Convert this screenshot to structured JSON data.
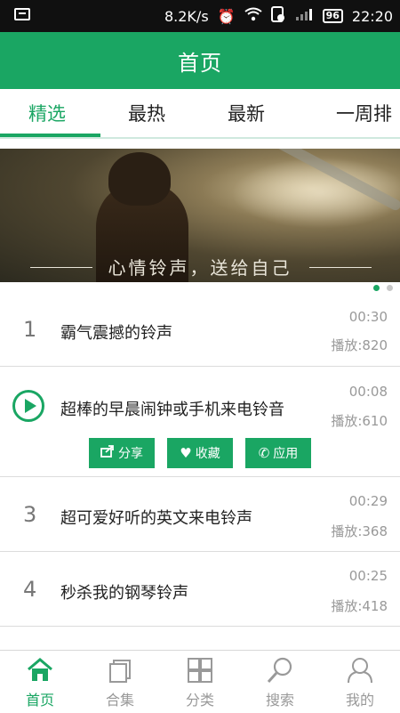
{
  "status_bar": {
    "speed": "8.2K/s",
    "battery": "96",
    "time": "22:20",
    "alarm_icon": "alarm-icon",
    "wifi_icon": "wifi-icon",
    "signal_icon": "signal-icon"
  },
  "app_bar": {
    "title": "首页"
  },
  "tabs": [
    {
      "label": "精选",
      "active": true
    },
    {
      "label": "最热"
    },
    {
      "label": "最新"
    },
    {
      "label": "一周排"
    }
  ],
  "banner": {
    "caption": "心情铃声，送给自己",
    "pages": 2,
    "current_page": 1
  },
  "ringtones": [
    {
      "rank": "1",
      "title": "霸气震撼的铃声",
      "duration": "00:30",
      "plays": "播放:820"
    },
    {
      "rank": "",
      "title": "超棒的早晨闹钟或手机来电铃音",
      "duration": "00:08",
      "plays": "播放:610",
      "expanded": true
    },
    {
      "rank": "3",
      "title": "超可爱好听的英文来电铃声",
      "duration": "00:29",
      "plays": "播放:368"
    },
    {
      "rank": "4",
      "title": "秒杀我的钢琴铃声",
      "duration": "00:25",
      "plays": "播放:418"
    }
  ],
  "actions": {
    "share": "分享",
    "favorite": "收藏",
    "apply": "应用"
  },
  "bottom_nav": [
    {
      "label": "首页",
      "icon": "home-icon",
      "active": true
    },
    {
      "label": "合集",
      "icon": "collection-icon"
    },
    {
      "label": "分类",
      "icon": "category-grid-icon"
    },
    {
      "label": "搜索",
      "icon": "search-icon"
    },
    {
      "label": "我的",
      "icon": "profile-icon"
    }
  ],
  "colors": {
    "accent": "#1aa663",
    "text": "#222222",
    "muted": "#999999"
  }
}
